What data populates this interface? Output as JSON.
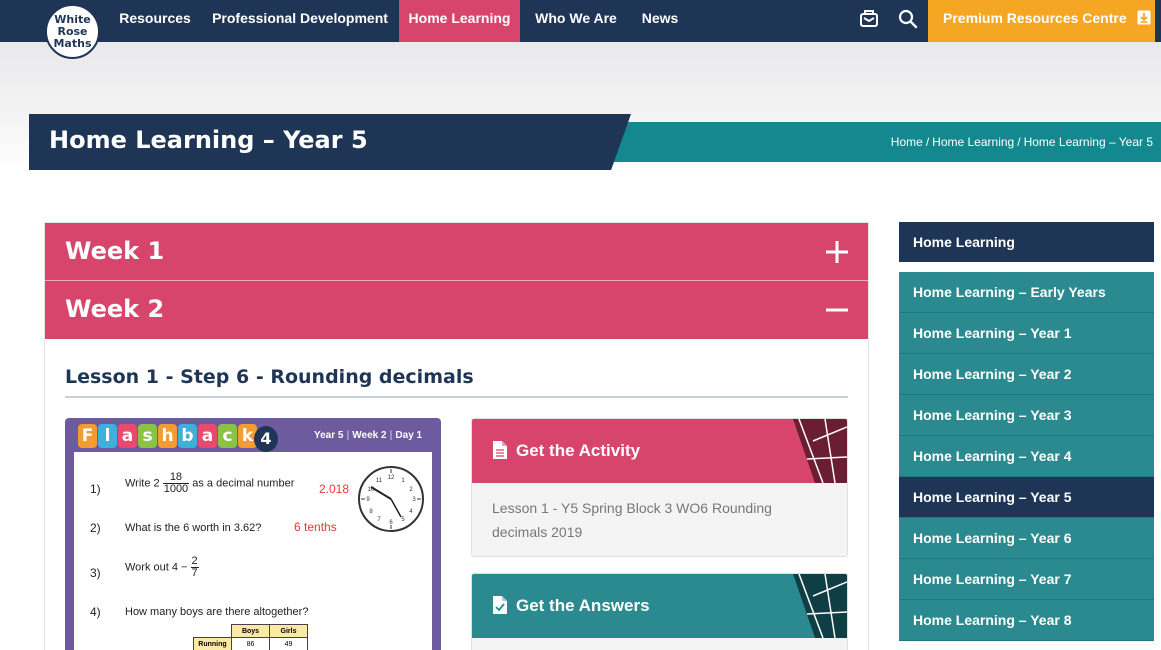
{
  "logo": {
    "line1": "White",
    "line2": "Rose",
    "line3": "Maths"
  },
  "nav": {
    "items": [
      {
        "label": "Resources"
      },
      {
        "label": "Professional Development"
      },
      {
        "label": "Home Learning"
      },
      {
        "label": "Who We Are"
      },
      {
        "label": "News"
      }
    ],
    "icons": [
      "contact-icon",
      "search-icon",
      "download-icon"
    ],
    "premium_label": "Premium Resources Centre"
  },
  "hero": {
    "title": "Home Learning – Year 5",
    "breadcrumb": [
      "Home",
      "Home Learning",
      "Home Learning – Year 5"
    ],
    "separator": "/"
  },
  "accordion": {
    "week1": "Week 1",
    "week2": "Week 2",
    "lesson_title": "Lesson 1 - Step 6 - Rounding decimals"
  },
  "worksheet": {
    "title_letters": [
      "F",
      "l",
      "a",
      "s",
      "h",
      "b",
      "a",
      "c",
      "k"
    ],
    "number": "4",
    "meta": [
      "Year 5",
      "Week 2",
      "Day 1"
    ],
    "questions": [
      {
        "num": "1)",
        "pre": "Write 2",
        "frac_n": "18",
        "frac_d": "1000",
        "post": "as a decimal number",
        "answer": "2.018"
      },
      {
        "num": "2)",
        "text": "What is the 6 worth in 3.62?",
        "answer": "6 tenths"
      },
      {
        "num": "3)",
        "pre": "Work out  4 −",
        "frac_n": "2",
        "frac_d": "7"
      },
      {
        "num": "4)",
        "text": "How many boys are there altogether?"
      }
    ],
    "table": {
      "headers": [
        "Boys",
        "Girls"
      ],
      "row_label": "Running",
      "row_values": [
        "86",
        "49"
      ]
    }
  },
  "cards": {
    "activity": {
      "label": "Get the Activity",
      "body": "Lesson 1 - Y5 Spring Block 3 WO6 Rounding decimals 2019"
    },
    "answers": {
      "label": "Get the Answers"
    }
  },
  "sidebar": {
    "title": "Home Learning",
    "items": [
      {
        "label": "Home Learning – Early Years"
      },
      {
        "label": "Home Learning – Year 1"
      },
      {
        "label": "Home Learning – Year 2"
      },
      {
        "label": "Home Learning – Year 3"
      },
      {
        "label": "Home Learning – Year 4"
      },
      {
        "label": "Home Learning – Year 5",
        "active": true
      },
      {
        "label": "Home Learning – Year 6"
      },
      {
        "label": "Home Learning – Year 7"
      },
      {
        "label": "Home Learning – Year 8"
      }
    ]
  },
  "colors": {
    "navy": "#1f3556",
    "pink": "#d7456d",
    "teal": "#2a8a8f",
    "orange": "#f5a623",
    "purple": "#6e5a9e"
  }
}
